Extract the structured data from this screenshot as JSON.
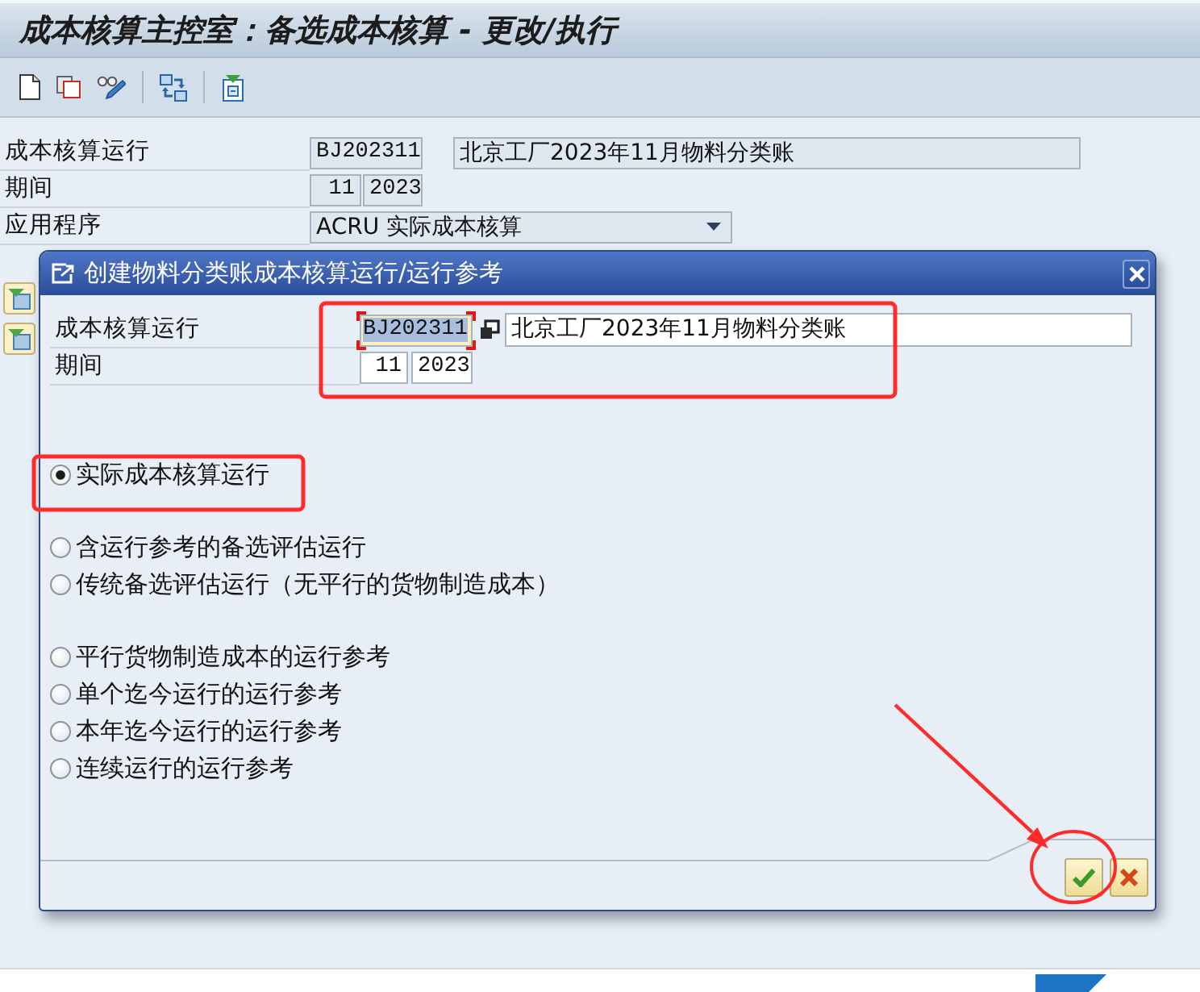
{
  "window": {
    "title": "成本核算主控室：备选成本核算 - 更改/执行"
  },
  "header_form": {
    "costing_run": {
      "label": "成本核算运行",
      "code": "BJ202311",
      "description": "北京工厂2023年11月物料分类账"
    },
    "period": {
      "label": "期间",
      "month": "11",
      "year": "2023"
    },
    "application": {
      "label": "应用程序",
      "value": "ACRU 实际成本核算"
    }
  },
  "dialog": {
    "title": "创建物料分类账成本核算运行/运行参考",
    "costing_run": {
      "label": "成本核算运行",
      "code": "BJ202311",
      "code_focused": true,
      "description": "北京工厂2023年11月物料分类账"
    },
    "period": {
      "label": "期间",
      "month": "11",
      "year": "2023"
    },
    "option_groups": [
      {
        "options": [
          {
            "label": "实际成本核算运行",
            "selected": true
          }
        ]
      },
      {
        "options": [
          {
            "label": "含运行参考的备选评估运行",
            "selected": false
          },
          {
            "label": "传统备选评估运行（无平行的货物制造成本）",
            "selected": false
          }
        ]
      },
      {
        "options": [
          {
            "label": "平行货物制造成本的运行参考",
            "selected": false
          },
          {
            "label": "单个迄今运行的运行参考",
            "selected": false
          },
          {
            "label": "本年迄今运行的运行参考",
            "selected": false
          },
          {
            "label": "连续运行的运行参考",
            "selected": false
          }
        ]
      }
    ]
  }
}
